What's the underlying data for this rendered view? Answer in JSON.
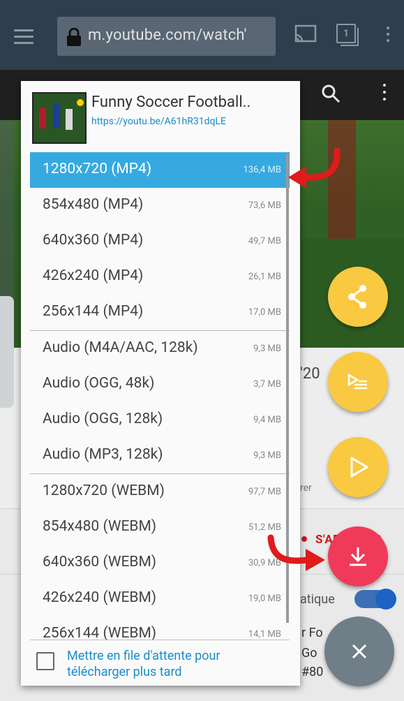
{
  "browser": {
    "url": "m.youtube.com/watch'"
  },
  "video_page": {
    "title_fragment": "'20",
    "meta_fragment": "rer",
    "subscribe_fragment": "S'ABONNER",
    "autoplay_fragment": "atique",
    "related": [
      "r Fo",
      "Go",
      "#80"
    ]
  },
  "dialog": {
    "title": "Funny Soccer Football..",
    "url": "https://youtu.be/A61hR31dqLE",
    "groups": [
      [
        {
          "format": "1280x720 (MP4)",
          "size": "136,4 MB",
          "selected": true
        },
        {
          "format": "854x480 (MP4)",
          "size": "73,6 MB"
        },
        {
          "format": "640x360 (MP4)",
          "size": "49,7 MB"
        },
        {
          "format": "426x240 (MP4)",
          "size": "26,1 MB"
        },
        {
          "format": "256x144 (MP4)",
          "size": "17,0 MB"
        }
      ],
      [
        {
          "format": "Audio (M4A/AAC, 128k)",
          "size": "9,3 MB"
        },
        {
          "format": "Audio (OGG, 48k)",
          "size": "3,7 MB"
        },
        {
          "format": "Audio (OGG, 128k)",
          "size": "9,4 MB"
        },
        {
          "format": "Audio (MP3, 128k)",
          "size": "9,3 MB"
        }
      ],
      [
        {
          "format": "1280x720 (WEBM)",
          "size": "97,7 MB"
        },
        {
          "format": "854x480 (WEBM)",
          "size": "51,2 MB"
        },
        {
          "format": "640x360 (WEBM)",
          "size": "30,9 MB"
        },
        {
          "format": "426x240 (WEBM)",
          "size": "19,0 MB"
        },
        {
          "format": "256x144 (WEBM)",
          "size": "14,1 MB"
        }
      ]
    ],
    "queue_line1": "Mettre en file d'attente pour",
    "queue_line2": "télécharger plus tard",
    "queue_checked": false
  },
  "fabs": {
    "share": "share-icon",
    "playlist": "playlist-add-icon",
    "play": "play-icon",
    "download": "download-icon",
    "close": "close-icon"
  },
  "colors": {
    "selected_row": "#36a9e1",
    "fab_yellow": "#f9c942",
    "fab_download": "#f03a59",
    "fab_close": "#6f7e87",
    "link": "#1a8dc9",
    "toolbar": "#2f3e4c"
  }
}
